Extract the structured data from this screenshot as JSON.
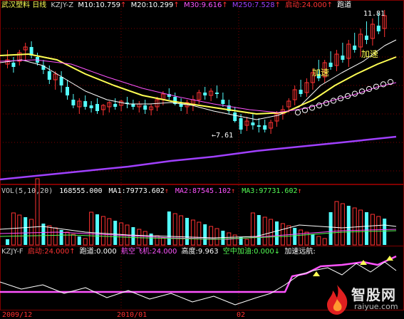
{
  "header": {
    "stock_name": "武汉塑料",
    "period": "日线",
    "indicator": "KZJY-Z",
    "ma10_label": "M10:",
    "ma10_value": "10.759",
    "ma20_label": "M20:",
    "ma20_value": "10.299",
    "ma30_label": "M30:",
    "ma30_value": "9.616",
    "ma250_label": "M250:",
    "ma250_value": "7.528",
    "start_label": "启动:",
    "start_value": "24.000",
    "runway_label": "跑道"
  },
  "price_panel": {
    "high_label": "11.81",
    "low_label": "7.61",
    "accel_label": "加速"
  },
  "vol_panel": {
    "title": "VOL(5,10,20)",
    "vol_value": "168555.000",
    "ma1_label": "MA1:",
    "ma1_value": "79773.602",
    "ma2_label": "MA2:",
    "ma2_value": "87545.102",
    "ma3_label": "MA3:",
    "ma3_value": "97731.602"
  },
  "kzjy_panel": {
    "title": "KZJY-F",
    "start_label": "启动:",
    "start_value": "24.000",
    "runway_label": "跑道:",
    "runway_value": "0.000",
    "flight_label": "航空飞机:",
    "flight_value": "24.000",
    "height_label": "高度:",
    "height_value": "9.963",
    "refuel_label": "空中加油:",
    "refuel_value": "0.000",
    "accel_far_label": "加速远航:"
  },
  "axis": {
    "dates": [
      "2009/12",
      "2010/01",
      "02"
    ]
  },
  "logo": {
    "name": "智股网",
    "url": "raiyue.com"
  },
  "colors": {
    "background": "#000000",
    "up": "#ff3232",
    "down": "#54fcfc",
    "ma10": "#ffffff",
    "ma20": "#ffff54",
    "ma30": "#ff54ff",
    "ma250": "#a040ff",
    "grid": "#800000"
  }
}
